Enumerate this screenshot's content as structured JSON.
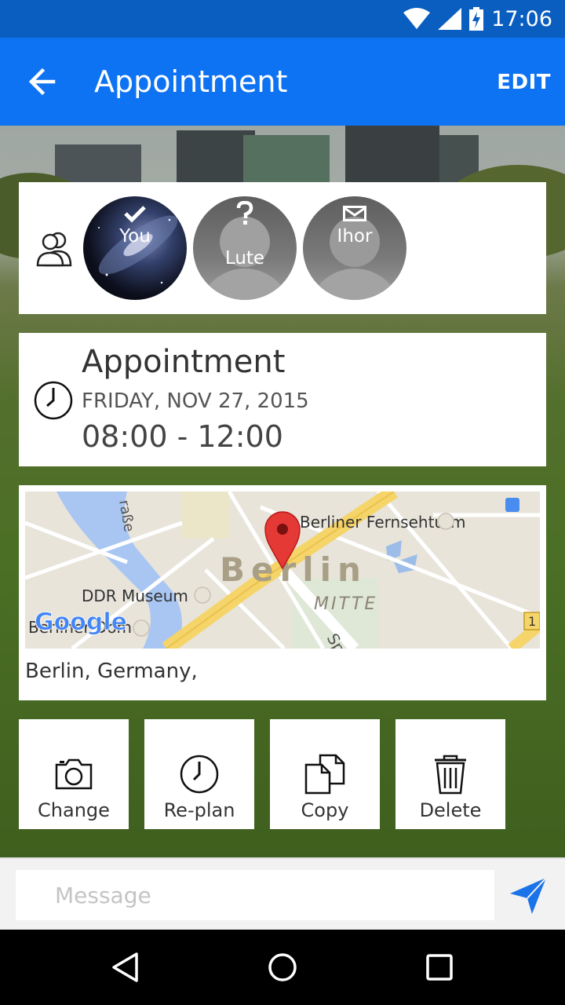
{
  "status_bar": {
    "time": "17:06",
    "icons": [
      "wifi-icon",
      "signal-icon",
      "battery-charging-icon"
    ]
  },
  "app_bar": {
    "title": "Appointment",
    "action_label": "EDIT",
    "back_icon": "arrow-back-icon"
  },
  "participants": {
    "group_icon": "people-icon",
    "items": [
      {
        "name": "You",
        "status": "accepted",
        "status_icon": "check-icon"
      },
      {
        "name": "Lute",
        "status": "unknown",
        "status_icon": "question-icon"
      },
      {
        "name": "Ihor",
        "status": "invited",
        "status_icon": "envelope-icon"
      }
    ]
  },
  "appointment": {
    "title": "Appointment",
    "date": "FRIDAY, NOV 27, 2015",
    "time_range": "08:00 - 12:00"
  },
  "location": {
    "address": "Berlin, Germany,",
    "map": {
      "city_label": "Berlin",
      "district_label": "MITTE",
      "poi_1": "Berliner Fernsehturm",
      "poi_2": "DDR Museum",
      "poi_3": "Berliner Dom",
      "street_1": "raße",
      "street_2": "Spa",
      "provider": "Google",
      "route_number": "1"
    }
  },
  "actions": [
    {
      "label": "Change",
      "icon": "camera-icon"
    },
    {
      "label": "Re-plan",
      "icon": "clock-icon"
    },
    {
      "label": "Copy",
      "icon": "copy-icon"
    },
    {
      "label": "Delete",
      "icon": "trash-icon"
    }
  ],
  "message": {
    "placeholder": "Message",
    "send_icon": "send-icon"
  },
  "nav_bar": {
    "icons": [
      "back-triangle-icon",
      "home-circle-icon",
      "recents-square-icon"
    ]
  },
  "colors": {
    "app_bar": "#0d73f2",
    "status_bar": "#0a5ec0",
    "send_icon": "#1a73e8",
    "map_pin": "#e53935"
  }
}
